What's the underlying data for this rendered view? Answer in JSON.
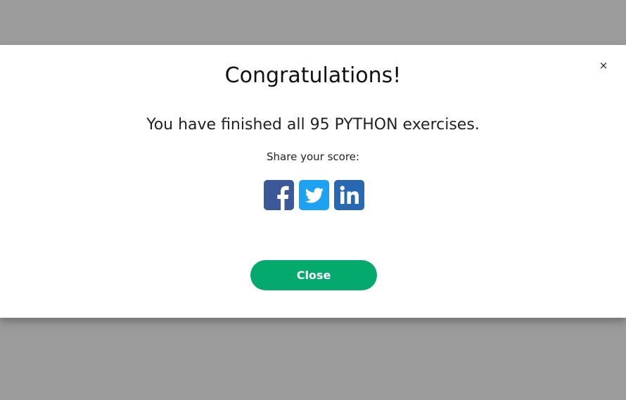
{
  "modal": {
    "close_icon_glyph": "×",
    "title": "Congratulations!",
    "message": "You have finished all 95 PYTHON exercises.",
    "share_label": "Share your score:",
    "close_button_label": "Close"
  },
  "share": [
    {
      "network": "facebook",
      "icon": "facebook-icon",
      "color": "#3b5998"
    },
    {
      "network": "twitter",
      "icon": "twitter-icon",
      "color": "#1da1f2"
    },
    {
      "network": "linkedin",
      "icon": "linkedin-icon",
      "color": "#2867b2"
    }
  ],
  "colors": {
    "overlay": "#9b9b9b",
    "modal_bg": "#ffffff",
    "accent_button": "#04aa6d"
  }
}
